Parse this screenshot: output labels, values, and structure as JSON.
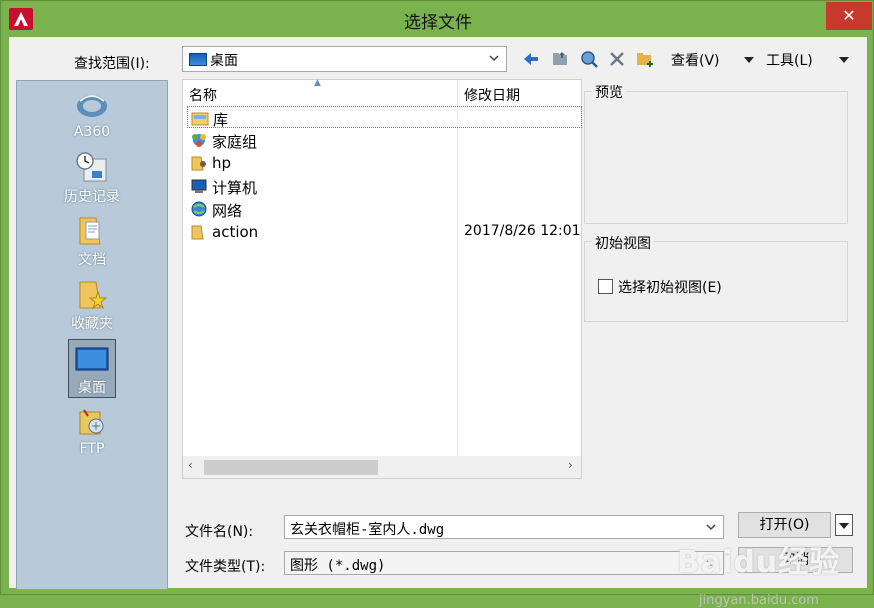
{
  "window": {
    "title": "选择文件",
    "close_glyph": "✕"
  },
  "toolbar": {
    "look_in_label": "查找范围(I):",
    "look_in_value": "桌面",
    "view_label": "查看(V)",
    "tools_label": "工具(L)",
    "icons": [
      "back-arrow-icon",
      "up-folder-icon",
      "search-web-icon",
      "delete-icon",
      "new-folder-icon"
    ]
  },
  "places": [
    {
      "label": "A360",
      "icon": "a360-icon"
    },
    {
      "label": "历史记录",
      "icon": "history-icon"
    },
    {
      "label": "文档",
      "icon": "documents-folder-icon"
    },
    {
      "label": "收藏夹",
      "icon": "favorites-folder-icon"
    },
    {
      "label": "桌面",
      "icon": "desktop-icon",
      "selected": true
    },
    {
      "label": "FTP",
      "icon": "ftp-icon"
    }
  ],
  "filelist": {
    "columns": [
      "名称",
      "修改日期"
    ],
    "rows": [
      {
        "name": "库",
        "date": "",
        "icon": "library-icon"
      },
      {
        "name": "家庭组",
        "date": "",
        "icon": "homegroup-icon"
      },
      {
        "name": "hp",
        "date": "",
        "icon": "user-folder-icon"
      },
      {
        "name": "计算机",
        "date": "",
        "icon": "computer-icon"
      },
      {
        "name": "网络",
        "date": "",
        "icon": "network-icon"
      },
      {
        "name": "action",
        "date": "2017/8/26 12:01",
        "icon": "folder-icon"
      }
    ]
  },
  "preview": {
    "title": "预览"
  },
  "initial_view": {
    "title": "初始视图",
    "checkbox_label": "选择初始视图(E)",
    "checked": false
  },
  "bottom": {
    "filename_label": "文件名(N):",
    "filename_value": "玄关衣帽柜-室内人.dwg",
    "filetype_label": "文件类型(T):",
    "filetype_value": "图形 (*.dwg)",
    "open_label": "打开(O)",
    "cancel_label": "取消"
  },
  "watermark": {
    "main": "Baidu经验",
    "sub": "jingyan.baidu.com"
  }
}
